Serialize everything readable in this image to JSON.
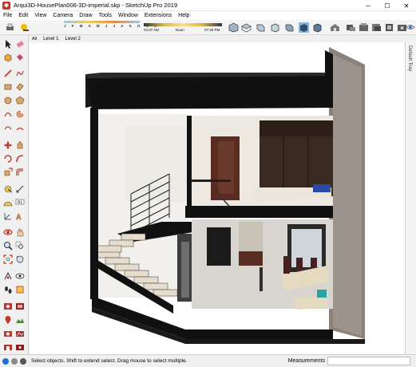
{
  "window": {
    "title": "Arqui3D-HousePlan006-3D-imperial.skp - SketchUp Pro 2019",
    "minimize": "─",
    "maximize": "☐",
    "close": "✕"
  },
  "menu": [
    "File",
    "Edit",
    "View",
    "Camera",
    "Draw",
    "Tools",
    "Window",
    "Extensions",
    "Help"
  ],
  "shadow": {
    "months": "J F M A M J J A S O N D",
    "start_time": "04:37 AM",
    "noon": "Noon",
    "end_time": "07:28 PM"
  },
  "scenes": {
    "all": "All",
    "tabs": [
      "Level 1",
      "Level 2"
    ]
  },
  "tray": {
    "label": "Default Tray"
  },
  "status": {
    "message": "Select objects. Shift to extend select. Drag mouse to select multiple.",
    "measurements_label": "Measurements",
    "measurements_value": ""
  },
  "colors": {
    "accent": "#c0392b",
    "viewport_bg": "#ffffff"
  },
  "icons": {
    "toolbar": [
      "print-icon",
      "shadow-icon",
      "iso-view-icon",
      "top-view-icon",
      "front-view-icon",
      "right-view-icon",
      "back-view-icon",
      "left-view-icon",
      "xray-icon",
      "wireframe-icon",
      "hidden-line-icon",
      "shaded-icon",
      "textured-icon",
      "monochrome-icon",
      "warehouse-icon",
      "share-model-icon",
      "extension-warehouse-icon",
      "layout-icon",
      "extension-manager-icon",
      "sandbox-icon",
      "photo-texture-icon",
      "user-icon"
    ],
    "tools": [
      "select-icon",
      "eraser-icon",
      "make-component-icon",
      "paint-bucket-icon",
      "line-icon",
      "freehand-icon",
      "rectangle-icon",
      "rotated-rect-icon",
      "circle-icon",
      "polygon-icon",
      "arc-icon",
      "pie-icon",
      "push-pull-icon",
      "follow-me-icon",
      "move-icon",
      "rotate-icon",
      "scale-icon",
      "offset-icon",
      "tape-measure-icon",
      "dimension-icon",
      "protractor-icon",
      "text-icon",
      "axes-icon",
      "3d-text-icon",
      "orbit-icon",
      "pan-icon",
      "zoom-icon",
      "zoom-window-icon",
      "zoom-extents-icon",
      "previous-icon",
      "position-camera-icon",
      "walk-icon",
      "look-around-icon",
      "section-plane-icon",
      "display-section-icon",
      "section-cuts-icon",
      "add-location-icon",
      "terrain-icon",
      "photo-icon",
      "warehouse-icon"
    ]
  }
}
